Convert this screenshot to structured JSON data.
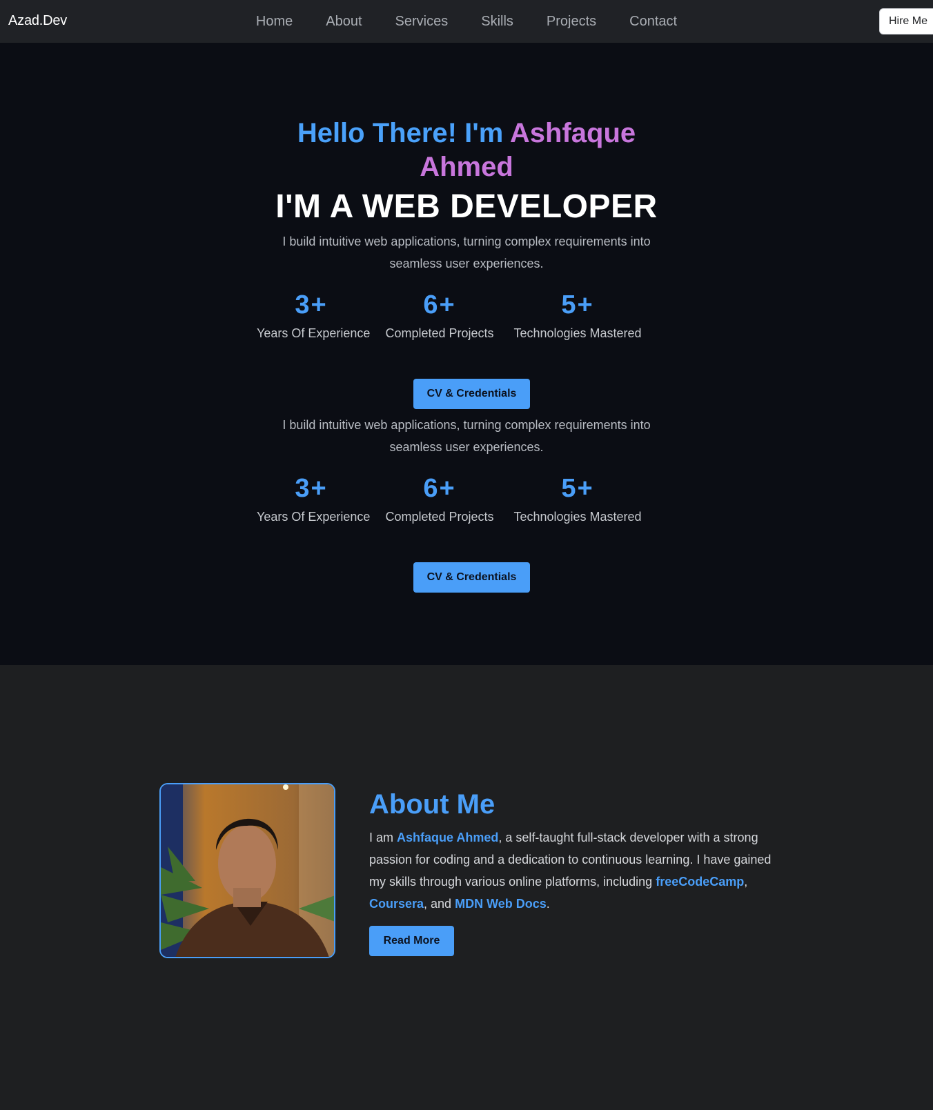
{
  "navbar": {
    "brand": "Azad.Dev",
    "links": [
      "Home",
      "About",
      "Services",
      "Skills",
      "Projects",
      "Contact"
    ],
    "hire_label": "Hire Me"
  },
  "hero": {
    "greeting_prefix": "Hello There! I'm",
    "name": "Ashfaque Ahmed",
    "role": "I'M A WEB DEVELOPER",
    "tagline": "I build intuitive web applications, turning complex requirements into seamless user experiences.",
    "stats": [
      {
        "value": "3+",
        "label": "Years Of Experience"
      },
      {
        "value": "6+",
        "label": "Completed Projects"
      },
      {
        "value": "5+",
        "label": "Technologies Mastered"
      }
    ],
    "cv_label": "CV & Credentials"
  },
  "about": {
    "title": "About Me",
    "intro": "I am",
    "name": "Ashfaque Ahmed",
    "text_1": ", a self-taught full-stack developer with a strong passion for coding and a dedication to continuous learning. I have gained my skills through various online platforms, including",
    "platforms": [
      "freeCodeCamp",
      "Coursera",
      "MDN Web Docs"
    ],
    "sep_1": ",",
    "sep_2": ", and",
    "end": ".",
    "read_more_label": "Read More"
  },
  "colors": {
    "accent": "#4a9ef8",
    "name_accent": "#c876dc",
    "hero_bg": "#0b0d14",
    "section_bg": "#1e1f21"
  }
}
